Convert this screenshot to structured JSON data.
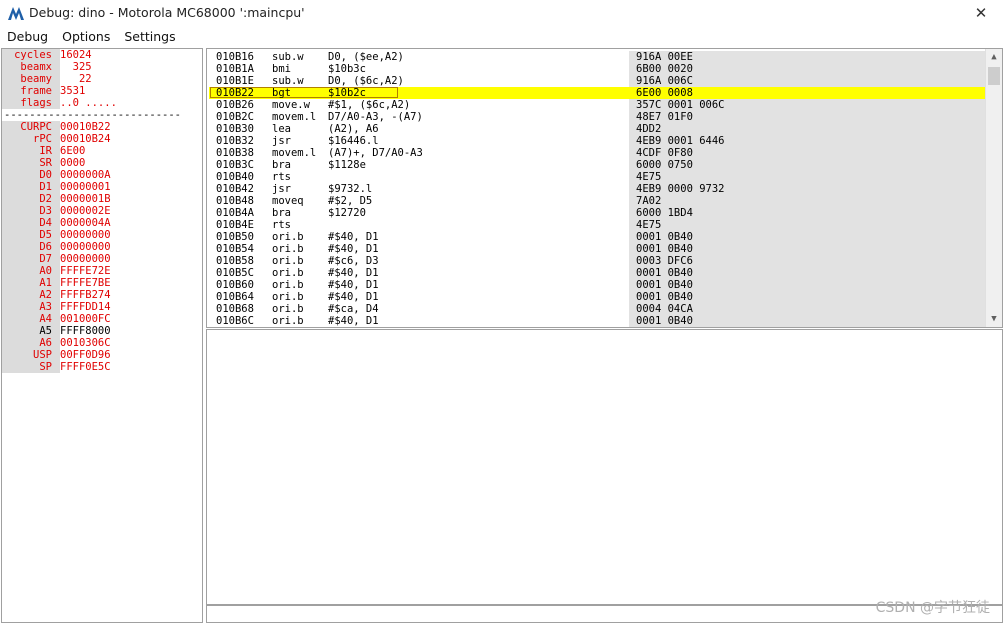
{
  "window": {
    "title": "Debug: dino - Motorola MC68000 ':maincpu'",
    "close_glyph": "✕"
  },
  "menu": [
    "Debug",
    "Options",
    "Settings"
  ],
  "registers_top": [
    {
      "name": "cycles",
      "value": "16024"
    },
    {
      "name": "beamx",
      "value": "  325"
    },
    {
      "name": "beamy",
      "value": "   22"
    },
    {
      "name": "frame",
      "value": "3531"
    },
    {
      "name": "flags",
      "value": "..0 ....."
    }
  ],
  "separator": "----------------------------",
  "registers": [
    {
      "name": "CURPC",
      "value": "00010B22",
      "style": "red"
    },
    {
      "name": "rPC",
      "value": "00010B24",
      "style": "red"
    },
    {
      "name": "IR",
      "value": "6E00",
      "style": "red"
    },
    {
      "name": "SR",
      "value": "0000",
      "style": "red"
    },
    {
      "name": "D0",
      "value": "0000000A",
      "style": "red"
    },
    {
      "name": "D1",
      "value": "00000001",
      "style": "red"
    },
    {
      "name": "D2",
      "value": "0000001B",
      "style": "red"
    },
    {
      "name": "D3",
      "value": "0000002E",
      "style": "red"
    },
    {
      "name": "D4",
      "value": "0000004A",
      "style": "red"
    },
    {
      "name": "D5",
      "value": "00000000",
      "style": "red"
    },
    {
      "name": "D6",
      "value": "00000000",
      "style": "red"
    },
    {
      "name": "D7",
      "value": "00000000",
      "style": "red"
    },
    {
      "name": "A0",
      "value": "FFFFE72E",
      "style": "red"
    },
    {
      "name": "A1",
      "value": "FFFFE7BE",
      "style": "red"
    },
    {
      "name": "A2",
      "value": "FFFFB274",
      "style": "red"
    },
    {
      "name": "A3",
      "value": "FFFFDD14",
      "style": "red"
    },
    {
      "name": "A4",
      "value": "001000FC",
      "style": "red"
    },
    {
      "name": "A5",
      "value": "FFFF8000",
      "style": "plain"
    },
    {
      "name": "A6",
      "value": "0010306C",
      "style": "red"
    },
    {
      "name": "USP",
      "value": "00FF0D96",
      "style": "red"
    },
    {
      "name": "SP",
      "value": "FFFF0E5C",
      "style": "red"
    }
  ],
  "disasm": [
    {
      "addr": "010B16",
      "mn": "sub.w",
      "op": "D0, ($ee,A2)",
      "hex": "916A 00EE"
    },
    {
      "addr": "010B1A",
      "mn": "bmi",
      "op": "$10b3c",
      "hex": "6B00 0020"
    },
    {
      "addr": "010B1E",
      "mn": "sub.w",
      "op": "D0, ($6c,A2)",
      "hex": "916A 006C"
    },
    {
      "addr": "010B22",
      "mn": "bgt",
      "op": "$10b2c",
      "hex": "6E00 0008",
      "current": true
    },
    {
      "addr": "010B26",
      "mn": "move.w",
      "op": "#$1, ($6c,A2)",
      "hex": "357C 0001 006C"
    },
    {
      "addr": "010B2C",
      "mn": "movem.l",
      "op": "D7/A0-A3, -(A7)",
      "hex": "48E7 01F0"
    },
    {
      "addr": "010B30",
      "mn": "lea",
      "op": "(A2), A6",
      "hex": "4DD2"
    },
    {
      "addr": "010B32",
      "mn": "jsr",
      "op": "$16446.l",
      "hex": "4EB9 0001 6446"
    },
    {
      "addr": "010B38",
      "mn": "movem.l",
      "op": "(A7)+, D7/A0-A3",
      "hex": "4CDF 0F80"
    },
    {
      "addr": "010B3C",
      "mn": "bra",
      "op": "$1128e",
      "hex": "6000 0750"
    },
    {
      "addr": "010B40",
      "mn": "rts",
      "op": "",
      "hex": "4E75"
    },
    {
      "addr": "010B42",
      "mn": "jsr",
      "op": "$9732.l",
      "hex": "4EB9 0000 9732"
    },
    {
      "addr": "010B48",
      "mn": "moveq",
      "op": "#$2, D5",
      "hex": "7A02"
    },
    {
      "addr": "010B4A",
      "mn": "bra",
      "op": "$12720",
      "hex": "6000 1BD4"
    },
    {
      "addr": "010B4E",
      "mn": "rts",
      "op": "",
      "hex": "4E75"
    },
    {
      "addr": "010B50",
      "mn": "ori.b",
      "op": "#$40, D1",
      "hex": "0001 0B40"
    },
    {
      "addr": "010B54",
      "mn": "ori.b",
      "op": "#$40, D1",
      "hex": "0001 0B40"
    },
    {
      "addr": "010B58",
      "mn": "ori.b",
      "op": "#$c6, D3",
      "hex": "0003 DFC6"
    },
    {
      "addr": "010B5C",
      "mn": "ori.b",
      "op": "#$40, D1",
      "hex": "0001 0B40"
    },
    {
      "addr": "010B60",
      "mn": "ori.b",
      "op": "#$40, D1",
      "hex": "0001 0B40"
    },
    {
      "addr": "010B64",
      "mn": "ori.b",
      "op": "#$40, D1",
      "hex": "0001 0B40"
    },
    {
      "addr": "010B68",
      "mn": "ori.b",
      "op": "#$ca, D4",
      "hex": "0004 04CA"
    },
    {
      "addr": "010B6C",
      "mn": "ori.b",
      "op": "#$40, D1",
      "hex": "0001 0B40"
    }
  ],
  "scroll": {
    "up": "▲",
    "down": "▼"
  },
  "watermark": "CSDN @字节狂徒"
}
